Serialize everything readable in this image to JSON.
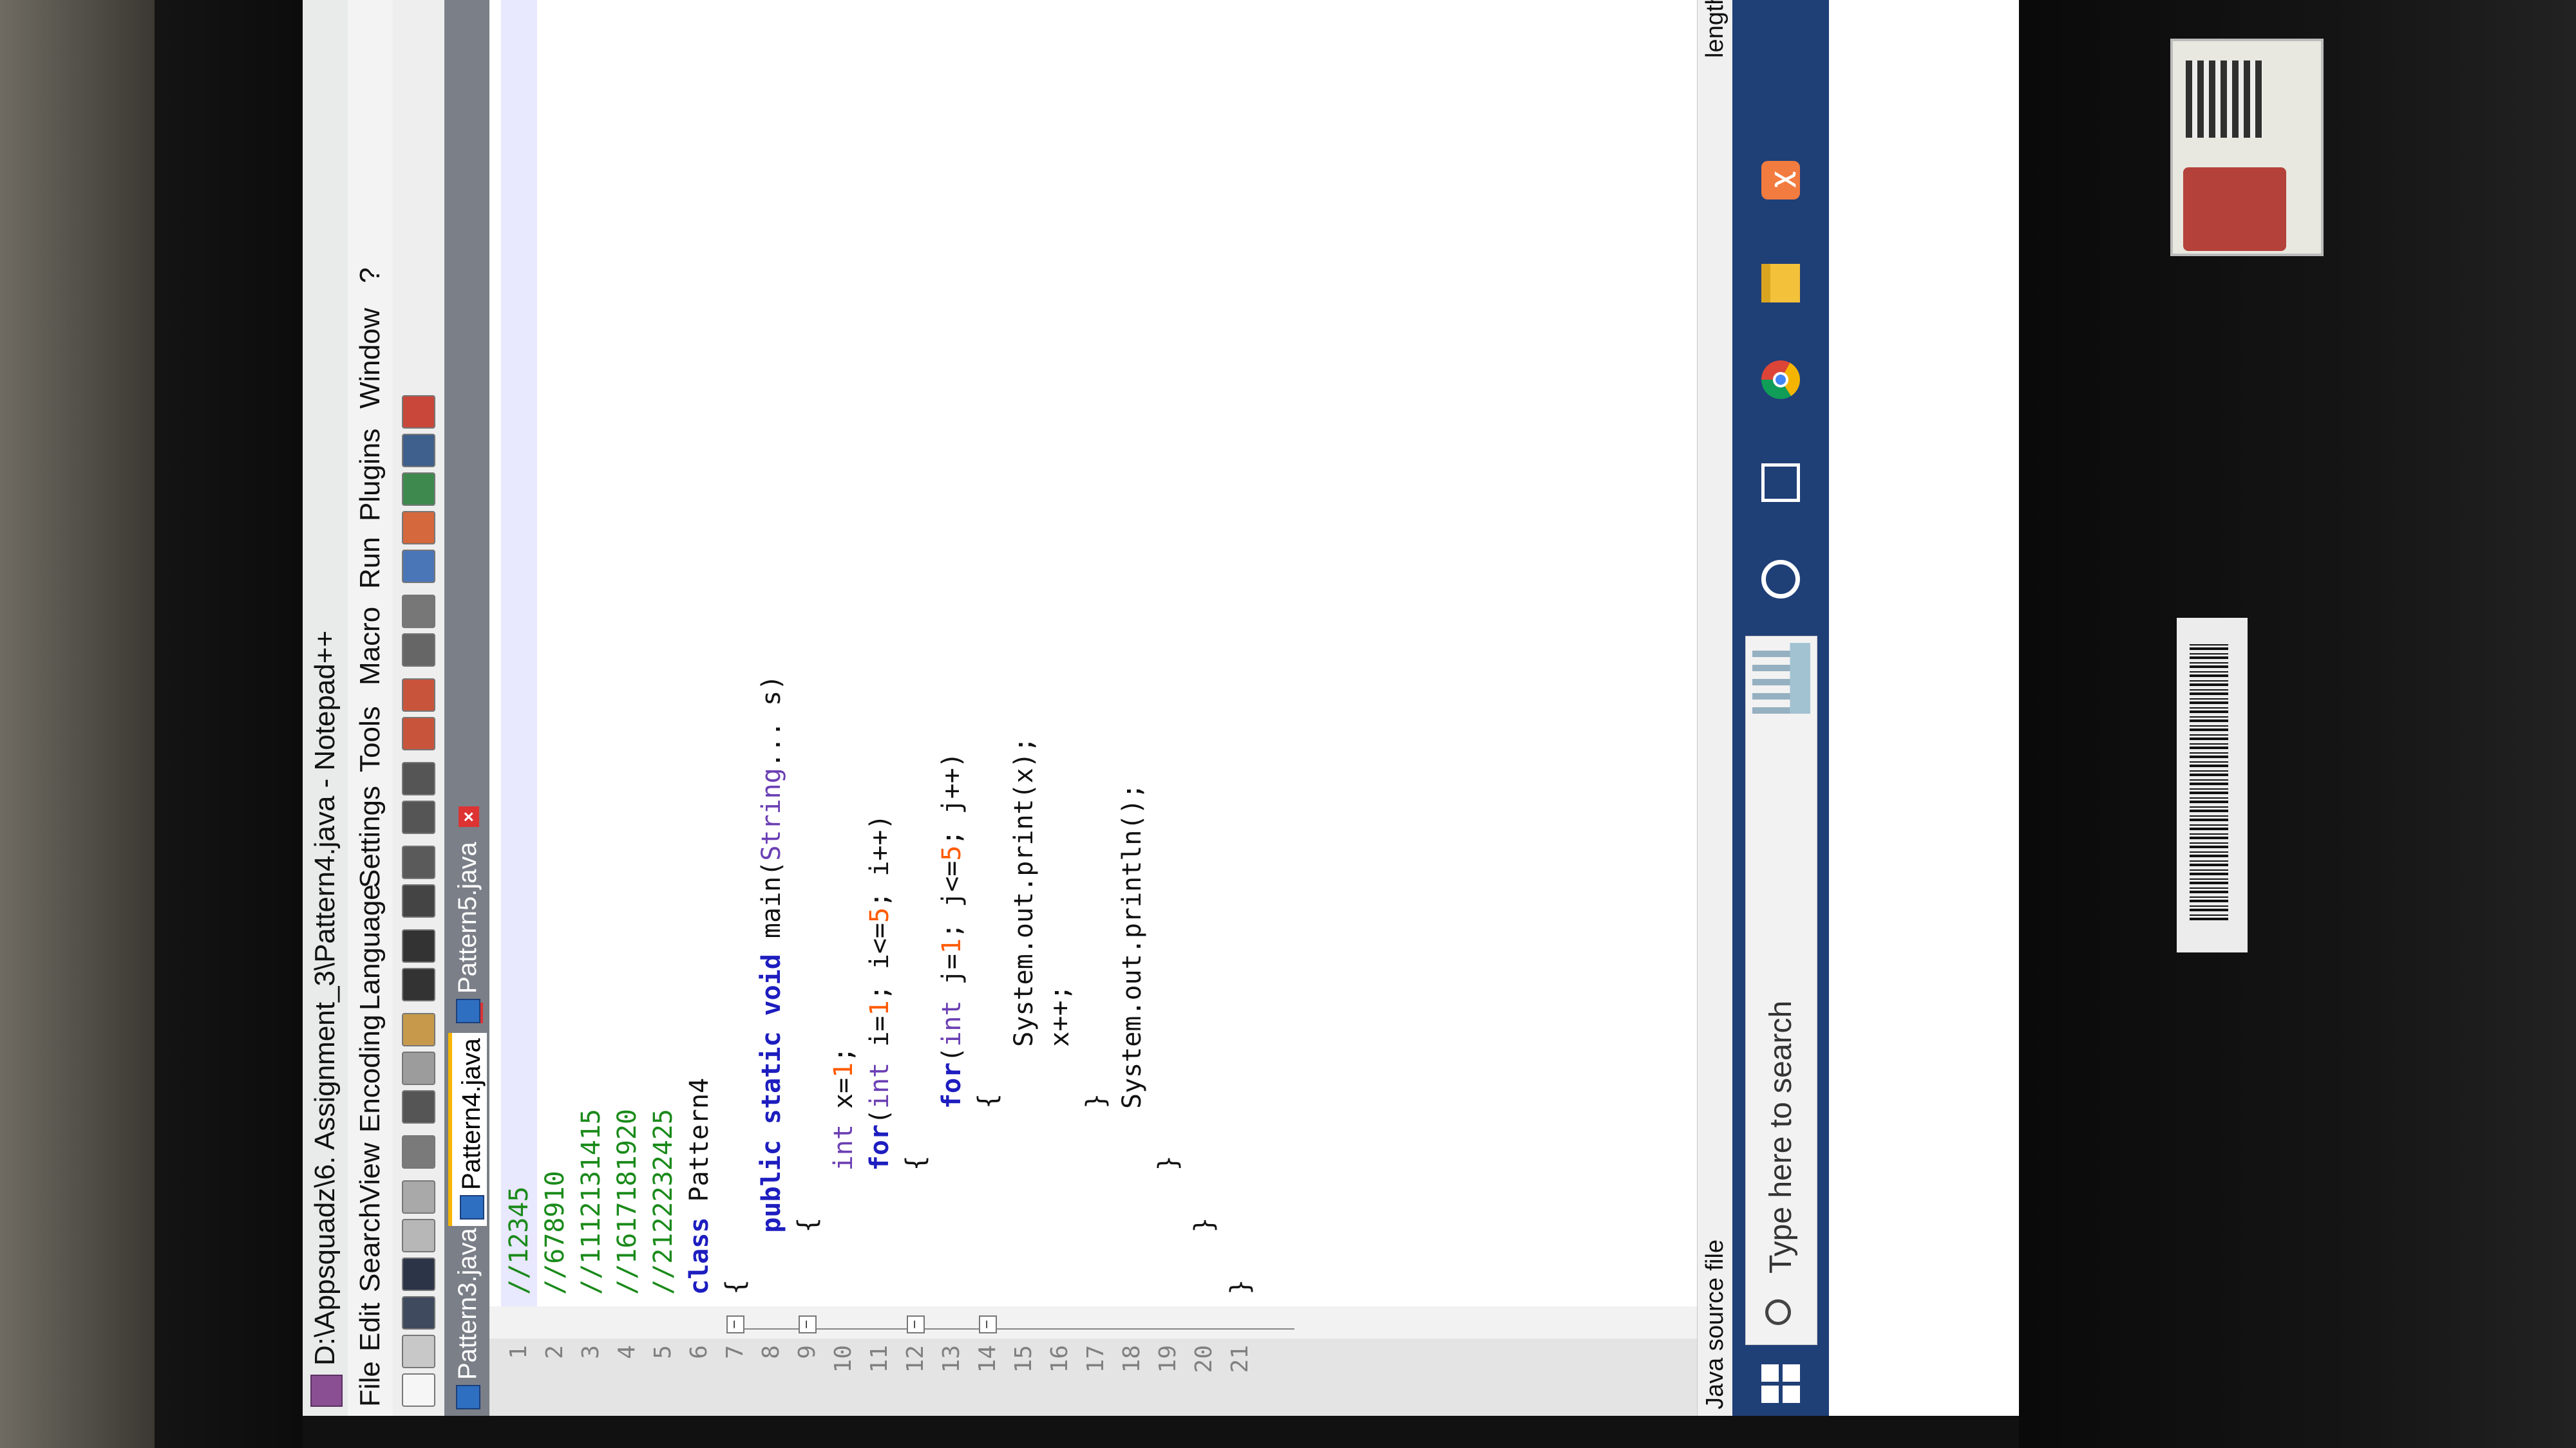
{
  "window": {
    "title": "D:\\Appsquadz\\6. Assignment_3\\Pattern4.java - Notepad++"
  },
  "menu": [
    "File",
    "Edit",
    "Search",
    "View",
    "Encoding",
    "Language",
    "Settings",
    "Tools",
    "Macro",
    "Run",
    "Plugins",
    "Window",
    "?"
  ],
  "toolbar": {
    "icons": [
      "new-file-icon",
      "open-file-icon",
      "save-icon",
      "save-all-icon",
      "close-icon",
      "close-all-icon",
      "print-icon",
      "cut-icon",
      "copy-icon",
      "paste-icon",
      "undo-icon",
      "redo-icon",
      "find-icon",
      "replace-icon",
      "zoom-in-icon",
      "zoom-out-icon",
      "sync-scroll-icon",
      "word-wrap-icon",
      "show-all-chars-icon",
      "indent-guide-icon",
      "doc-map-icon",
      "function-list-icon",
      "folder-workspace-icon",
      "monitoring-icon",
      "record-macro-icon"
    ]
  },
  "tabs": [
    {
      "label": "Pattern3.java",
      "active": false
    },
    {
      "label": "Pattern4.java",
      "active": true
    },
    {
      "label": "Pattern5.java",
      "active": false
    }
  ],
  "editor": {
    "current_line": 1,
    "lines": [
      {
        "n": "1",
        "text": "//12345"
      },
      {
        "n": "2",
        "text": "//678910"
      },
      {
        "n": "3",
        "text": "//1112131415"
      },
      {
        "n": "4",
        "text": "//1617181920"
      },
      {
        "n": "5",
        "text": "//2122232425"
      },
      {
        "n": "6",
        "text": "class Pattern4"
      },
      {
        "n": "7",
        "text": "{"
      },
      {
        "n": "8",
        "text": "    public static void main(String... s)"
      },
      {
        "n": "9",
        "text": "    {"
      },
      {
        "n": "10",
        "text": "        int x=1;"
      },
      {
        "n": "11",
        "text": "        for(int i=1; i<=5; i++)"
      },
      {
        "n": "12",
        "text": "        {"
      },
      {
        "n": "13",
        "text": "            for(int j=1; j<=5; j++)"
      },
      {
        "n": "14",
        "text": "            {"
      },
      {
        "n": "15",
        "text": "                System.out.print(x);"
      },
      {
        "n": "16",
        "text": "                x++;"
      },
      {
        "n": "17",
        "text": "            }"
      },
      {
        "n": "18",
        "text": "            System.out.println();"
      },
      {
        "n": "19",
        "text": "        }"
      },
      {
        "n": "20",
        "text": "    }"
      },
      {
        "n": "21",
        "text": "}"
      }
    ]
  },
  "status": {
    "file_type": "Java source file",
    "length_label": "length"
  },
  "taskbar": {
    "search_placeholder": "Type here to search",
    "apps": [
      "cortana-icon",
      "task-view-icon",
      "chrome-icon",
      "file-explorer-icon",
      "xampp-icon"
    ]
  },
  "colors": {
    "keyword": "#1d1dbf",
    "number": "#ff5a00",
    "comment": "#1a8a1a",
    "taskbar": "#1f3f77",
    "active_tab_accent": "#f7b500"
  }
}
